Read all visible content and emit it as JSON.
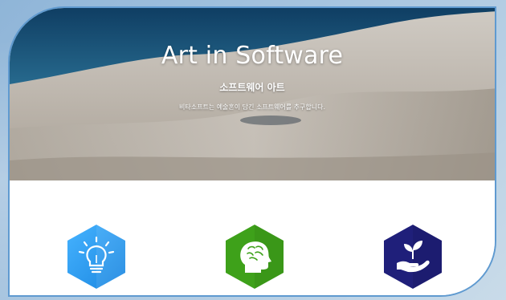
{
  "hero": {
    "title": "Art in Software",
    "subtitle": "소프트웨어 아트",
    "description": "비타소프트는 예술혼이 담긴 소프트웨어를 추구합니다."
  },
  "features": [
    {
      "icon": "lightbulb-icon",
      "color": "#2a9df4"
    },
    {
      "icon": "brain-head-icon",
      "color": "#3ea11a"
    },
    {
      "icon": "hand-plant-icon",
      "color": "#1f1f7a"
    }
  ],
  "colors": {
    "frame_border": "#5f9ad0",
    "background_gradient": "#a9c6e0"
  }
}
